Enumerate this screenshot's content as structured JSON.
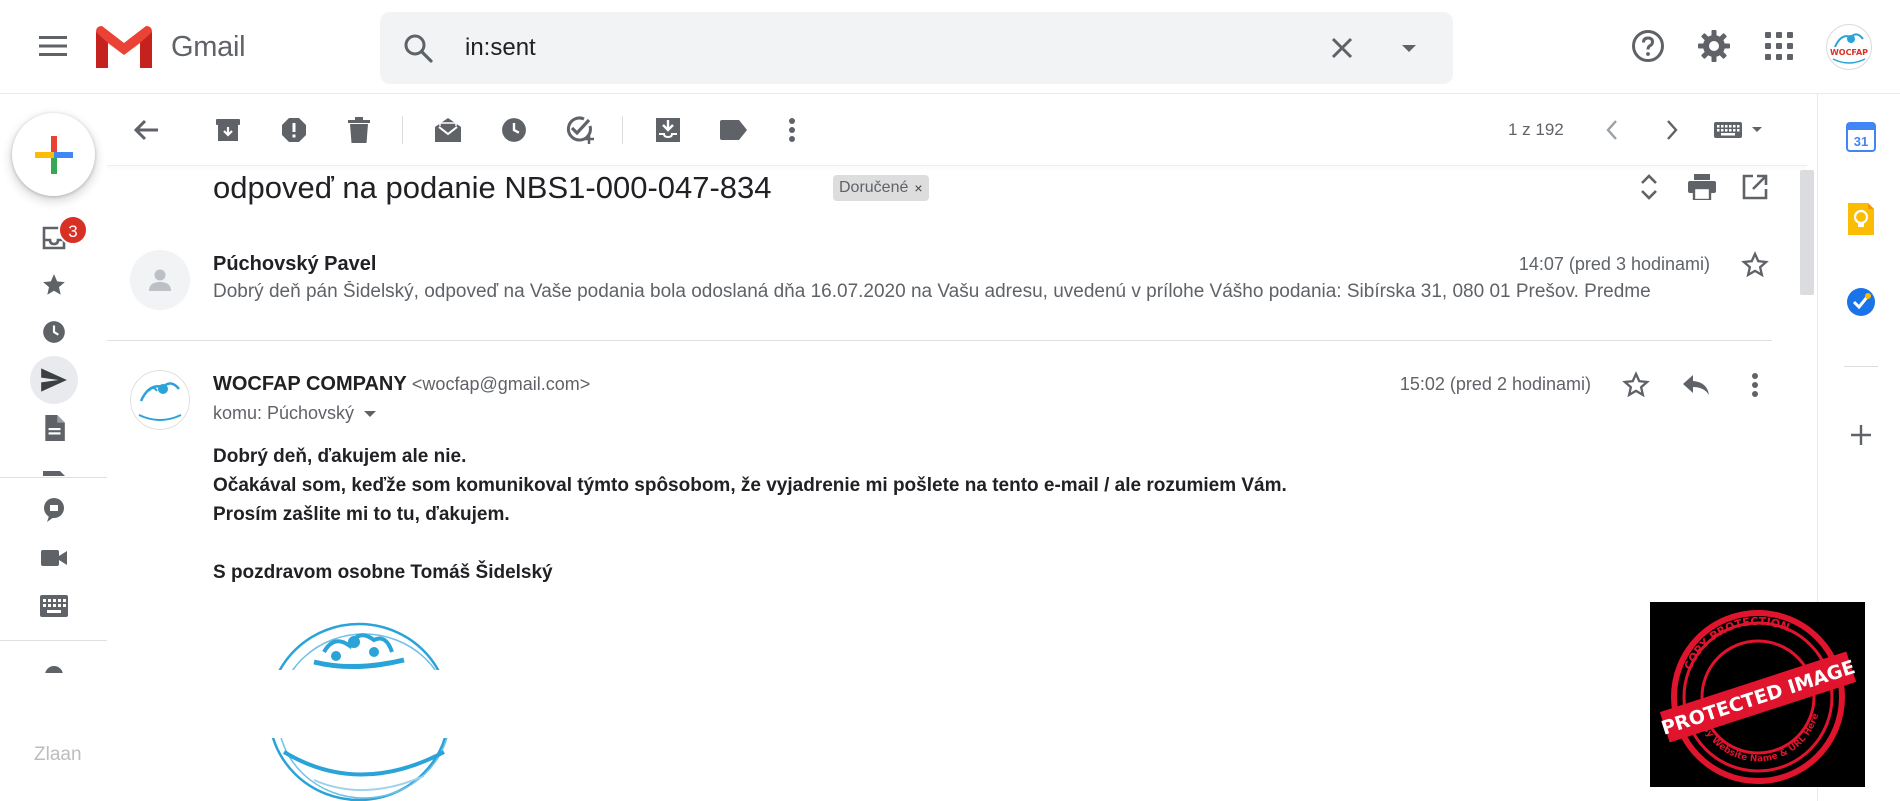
{
  "header": {
    "app_name": "Gmail",
    "search": {
      "query": "in:sent"
    },
    "account_logo_text": "WOCFAP"
  },
  "nav": {
    "inbox_badge": "3",
    "faded_label": "Zlaan"
  },
  "toolbar": {
    "pager": "1 z 192"
  },
  "thread": {
    "subject": "odpoveď na podanie NBS1-000-047-834",
    "label": "Doručené",
    "label_remove": "×"
  },
  "messages": [
    {
      "sender": "Púchovský Pavel",
      "time": "14:07 (pred 3 hodinami)",
      "snippet": "Dobrý deň pán Šidelský, odpoveď na Vaše podania bola odoslaná dňa 16.07.2020 na Vašu adresu, uvedenú v prílohe Vášho podania: Sibírska 31, 080 01 Prešov. Predme"
    },
    {
      "sender": "WOCFAP COMPANY",
      "sender_email": "<wocfap@gmail.com>",
      "time": "15:02 (pred 2 hodinami)",
      "to": "komu: Púchovský",
      "body": [
        "Dobrý deň, ďakujem ale nie.",
        "Očakával som, keďže som komunikoval týmto spôsobom, že vyjadrenie mi pošlete na tento e-mail / ale rozumiem Vám.",
        "Prosím zašlite mi to tu, ďakujem."
      ],
      "signature": "S pozdravom osobne Tomáš Šidelský"
    }
  ],
  "right_panel": {
    "calendar_day": "31"
  },
  "watermark": {
    "main_text": "PROTECTED IMAGE",
    "ring_top_text": "COPY PROTECTION",
    "ring_bottom_text": "By Website Name & URL Here"
  },
  "colors": {
    "gmail_red": "#EA4335",
    "gmail_blue": "#4285F4",
    "gmail_yellow": "#FBBC04",
    "gmail_green": "#34A853",
    "badge_red": "#D93025",
    "icon_grey": "#5F6368",
    "stamp_red": "#E0142D"
  }
}
